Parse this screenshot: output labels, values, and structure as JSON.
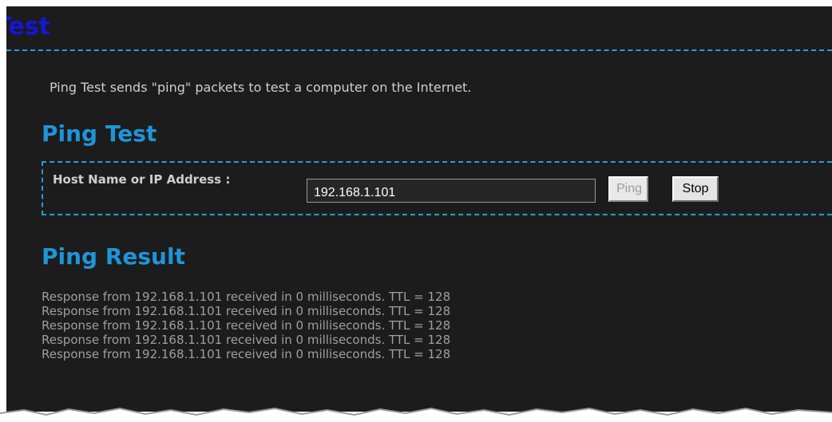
{
  "page": {
    "heading": "Test",
    "intro": "Ping Test sends \"ping\" packets to test a computer on the Internet."
  },
  "ping_test": {
    "title": "Ping Test",
    "host_label": "Host Name or IP Address :",
    "host_value": "192.168.1.101",
    "ping_button": "Ping",
    "ping_button_state": "disabled",
    "stop_button": "Stop"
  },
  "ping_result": {
    "title": "Ping Result",
    "lines": [
      "Response from 192.168.1.101 received in 0 milliseconds. TTL = 128",
      "Response from 192.168.1.101 received in 0 milliseconds. TTL = 128",
      "Response from 192.168.1.101 received in 0 milliseconds. TTL = 128",
      "Response from 192.168.1.101 received in 0 milliseconds. TTL = 128",
      "Response from 192.168.1.101 received in 0 milliseconds. TTL = 128"
    ]
  },
  "colors": {
    "background": "#1c1c1c",
    "heading": "#1416d8",
    "accent": "#1e95d9",
    "border": "#2a9bd4",
    "text": "#cfcfcf",
    "result_text": "#9f9f9f"
  }
}
